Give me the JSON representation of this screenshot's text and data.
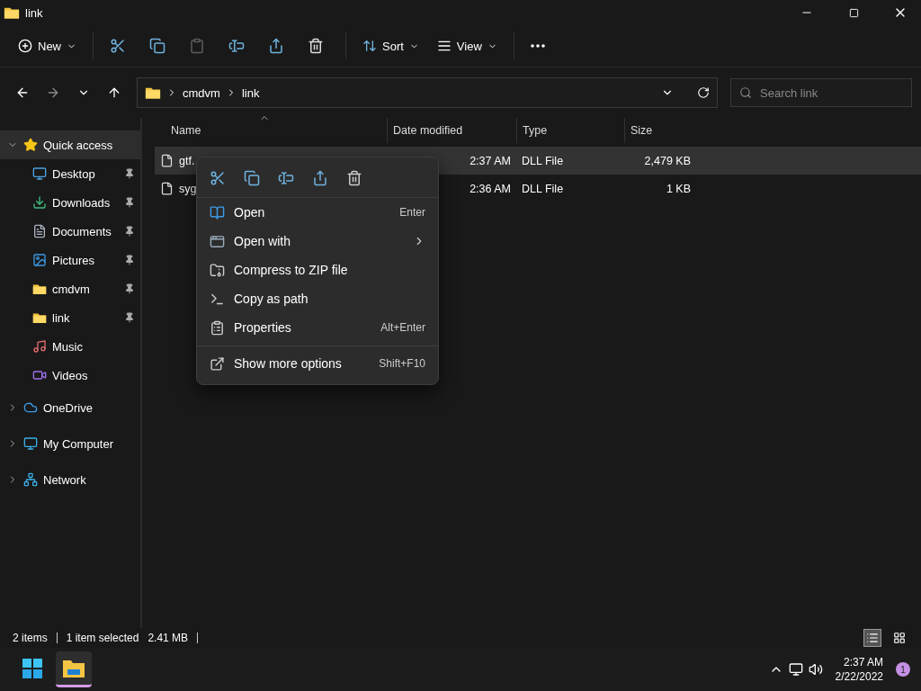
{
  "window": {
    "title": "link"
  },
  "toolbar": [
    {
      "kind": "menu",
      "label": "New"
    },
    {
      "kind": "icon",
      "disabled": false
    },
    {
      "kind": "icon",
      "disabled": false
    },
    {
      "kind": "icon",
      "disabled": true
    },
    {
      "kind": "icon",
      "disabled": false
    },
    {
      "kind": "icon",
      "disabled": false
    },
    {
      "kind": "icon",
      "disabled": false
    },
    {
      "kind": "menu",
      "label": "Sort"
    },
    {
      "kind": "menu",
      "label": "View"
    },
    {
      "kind": "more"
    }
  ],
  "address": {
    "crumbs": [
      "cmdvm",
      "link"
    ]
  },
  "search": {
    "placeholder": "Search link"
  },
  "sidebar": {
    "items": [
      {
        "label": "Quick access",
        "selected": true,
        "expanded": true,
        "children": [
          {
            "label": "Desktop",
            "pinned": true
          },
          {
            "label": "Downloads",
            "pinned": true
          },
          {
            "label": "Documents",
            "pinned": true
          },
          {
            "label": "Pictures",
            "pinned": true
          },
          {
            "label": "cmdvm",
            "pinned": true
          },
          {
            "label": "link",
            "pinned": true
          },
          {
            "label": "Music",
            "pinned": false
          },
          {
            "label": "Videos",
            "pinned": false
          }
        ]
      },
      {
        "label": "OneDrive",
        "selected": false,
        "expanded": false
      },
      {
        "label": "My Computer",
        "selected": false,
        "expanded": false
      },
      {
        "label": "Network",
        "selected": false,
        "expanded": false
      }
    ]
  },
  "table": {
    "columns": [
      {
        "label": "Name",
        "sorted": true
      },
      {
        "label": "Date modified",
        "sorted": false
      },
      {
        "label": "Type",
        "sorted": false
      },
      {
        "label": "Size",
        "sorted": false
      }
    ],
    "rows": [
      {
        "name": "gtf.",
        "date": "2:37 AM",
        "type": "DLL File",
        "size": "2,479 KB",
        "selected": true
      },
      {
        "name": "syg",
        "date": "2:36 AM",
        "type": "DLL File",
        "size": "1 KB",
        "selected": false
      }
    ]
  },
  "context_menu": {
    "items": [
      {
        "label": "Open",
        "shortcut": "Enter",
        "submenu": false,
        "separator_before": false
      },
      {
        "label": "Open with",
        "submenu": true,
        "separator_before": false
      },
      {
        "label": "Compress to ZIP file",
        "submenu": false,
        "separator_before": false
      },
      {
        "label": "Copy as path",
        "submenu": false,
        "separator_before": false
      },
      {
        "label": "Properties",
        "shortcut": "Alt+Enter",
        "submenu": false,
        "separator_before": false
      },
      {
        "label": "Show more options",
        "shortcut": "Shift+F10",
        "submenu": false,
        "separator_before": true
      }
    ]
  },
  "status_bar": {
    "items": [
      "2 items",
      "1 item selected",
      "2.41 MB"
    ],
    "views": [
      {
        "selected": true
      },
      {
        "selected": false
      }
    ]
  },
  "taskbar": {
    "apps": [
      {
        "selected": false
      },
      {
        "selected": true
      }
    ],
    "time": "2:37 AM",
    "date": "2/22/2022",
    "notifications": "1"
  }
}
